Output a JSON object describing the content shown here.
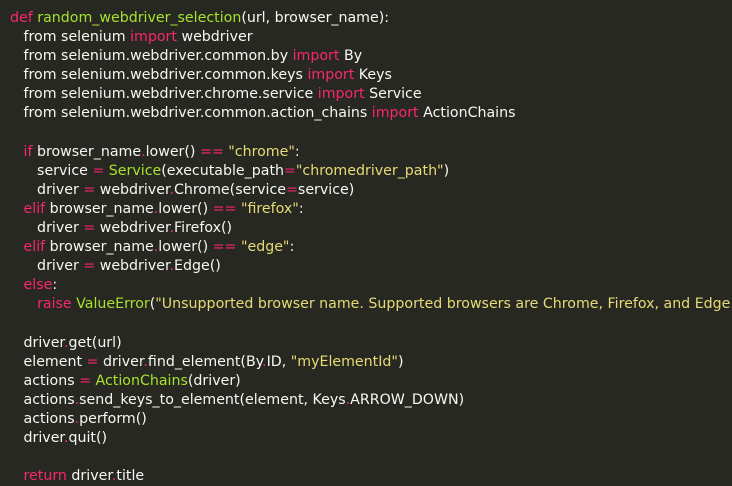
{
  "editor": {
    "language": "python",
    "colors": {
      "background": "#272822",
      "text": "#f8f8f2",
      "keyword": "#f92672",
      "function": "#a6e22e",
      "string": "#e6db74"
    },
    "lines": [
      [
        [
          "kw",
          "def"
        ],
        [
          "p",
          " "
        ],
        [
          "fn",
          "random_webdriver_selection"
        ],
        [
          "p",
          "(url, browser_name):"
        ]
      ],
      [
        [
          "p",
          "   from selenium "
        ],
        [
          "kw",
          "import"
        ],
        [
          "p",
          " webdriver"
        ]
      ],
      [
        [
          "p",
          "   from selenium.webdriver.common.by "
        ],
        [
          "kw",
          "import"
        ],
        [
          "p",
          " By"
        ]
      ],
      [
        [
          "p",
          "   from selenium.webdriver.common.keys "
        ],
        [
          "kw",
          "import"
        ],
        [
          "p",
          " Keys"
        ]
      ],
      [
        [
          "p",
          "   from selenium.webdriver.chrome.service "
        ],
        [
          "kw",
          "import"
        ],
        [
          "p",
          " Service"
        ]
      ],
      [
        [
          "p",
          "   from selenium.webdriver.common.action_chains "
        ],
        [
          "kw",
          "import"
        ],
        [
          "p",
          " ActionChains"
        ]
      ],
      [],
      [
        [
          "p",
          "   "
        ],
        [
          "kw",
          "if"
        ],
        [
          "p",
          " browser_name"
        ],
        [
          "kw",
          "."
        ],
        [
          "p",
          "lower() "
        ],
        [
          "kw",
          "=="
        ],
        [
          "p",
          " "
        ],
        [
          "str",
          "\"chrome\""
        ],
        [
          "p",
          ":"
        ]
      ],
      [
        [
          "p",
          "      service "
        ],
        [
          "kw",
          "="
        ],
        [
          "p",
          " "
        ],
        [
          "fn",
          "Service"
        ],
        [
          "p",
          "(executable_path"
        ],
        [
          "kw",
          "="
        ],
        [
          "str",
          "\"chromedriver_path\""
        ],
        [
          "p",
          ")"
        ]
      ],
      [
        [
          "p",
          "      driver "
        ],
        [
          "kw",
          "="
        ],
        [
          "p",
          " webdriver"
        ],
        [
          "kw",
          "."
        ],
        [
          "p",
          "Chrome(service"
        ],
        [
          "kw",
          "="
        ],
        [
          "p",
          "service)"
        ]
      ],
      [
        [
          "p",
          "   "
        ],
        [
          "kw",
          "elif"
        ],
        [
          "p",
          " browser_name"
        ],
        [
          "kw",
          "."
        ],
        [
          "p",
          "lower() "
        ],
        [
          "kw",
          "=="
        ],
        [
          "p",
          " "
        ],
        [
          "str",
          "\"firefox\""
        ],
        [
          "p",
          ":"
        ]
      ],
      [
        [
          "p",
          "      driver "
        ],
        [
          "kw",
          "="
        ],
        [
          "p",
          " webdriver"
        ],
        [
          "kw",
          "."
        ],
        [
          "p",
          "Firefox()"
        ]
      ],
      [
        [
          "p",
          "   "
        ],
        [
          "kw",
          "elif"
        ],
        [
          "p",
          " browser_name"
        ],
        [
          "kw",
          "."
        ],
        [
          "p",
          "lower() "
        ],
        [
          "kw",
          "=="
        ],
        [
          "p",
          " "
        ],
        [
          "str",
          "\"edge\""
        ],
        [
          "p",
          ":"
        ]
      ],
      [
        [
          "p",
          "      driver "
        ],
        [
          "kw",
          "="
        ],
        [
          "p",
          " webdriver"
        ],
        [
          "kw",
          "."
        ],
        [
          "p",
          "Edge()"
        ]
      ],
      [
        [
          "p",
          "   "
        ],
        [
          "kw",
          "else"
        ],
        [
          "p",
          ":"
        ]
      ],
      [
        [
          "p",
          "      "
        ],
        [
          "kw",
          "raise"
        ],
        [
          "p",
          " "
        ],
        [
          "fn",
          "ValueError"
        ],
        [
          "p",
          "("
        ],
        [
          "str",
          "\"Unsupported browser name. Supported browsers are Chrome, Firefox, and Edge.\""
        ],
        [
          "p",
          ")"
        ]
      ],
      [],
      [
        [
          "p",
          "   driver"
        ],
        [
          "kw",
          "."
        ],
        [
          "p",
          "get(url)"
        ]
      ],
      [
        [
          "p",
          "   element "
        ],
        [
          "kw",
          "="
        ],
        [
          "p",
          " driver"
        ],
        [
          "kw",
          "."
        ],
        [
          "p",
          "find_element(By"
        ],
        [
          "kw",
          "."
        ],
        [
          "p",
          "ID, "
        ],
        [
          "str",
          "\"myElementId\""
        ],
        [
          "p",
          ")"
        ]
      ],
      [
        [
          "p",
          "   actions "
        ],
        [
          "kw",
          "="
        ],
        [
          "p",
          " "
        ],
        [
          "fn",
          "ActionChains"
        ],
        [
          "p",
          "(driver)"
        ]
      ],
      [
        [
          "p",
          "   actions"
        ],
        [
          "kw",
          "."
        ],
        [
          "p",
          "send_keys_to_element(element, Keys"
        ],
        [
          "kw",
          "."
        ],
        [
          "p",
          "ARROW_DOWN)"
        ]
      ],
      [
        [
          "p",
          "   actions"
        ],
        [
          "kw",
          "."
        ],
        [
          "p",
          "perform()"
        ]
      ],
      [
        [
          "p",
          "   driver"
        ],
        [
          "kw",
          "."
        ],
        [
          "p",
          "quit()"
        ]
      ],
      [],
      [
        [
          "p",
          "   "
        ],
        [
          "kw",
          "return"
        ],
        [
          "p",
          " driver"
        ],
        [
          "kw",
          "."
        ],
        [
          "p",
          "title"
        ]
      ]
    ]
  }
}
